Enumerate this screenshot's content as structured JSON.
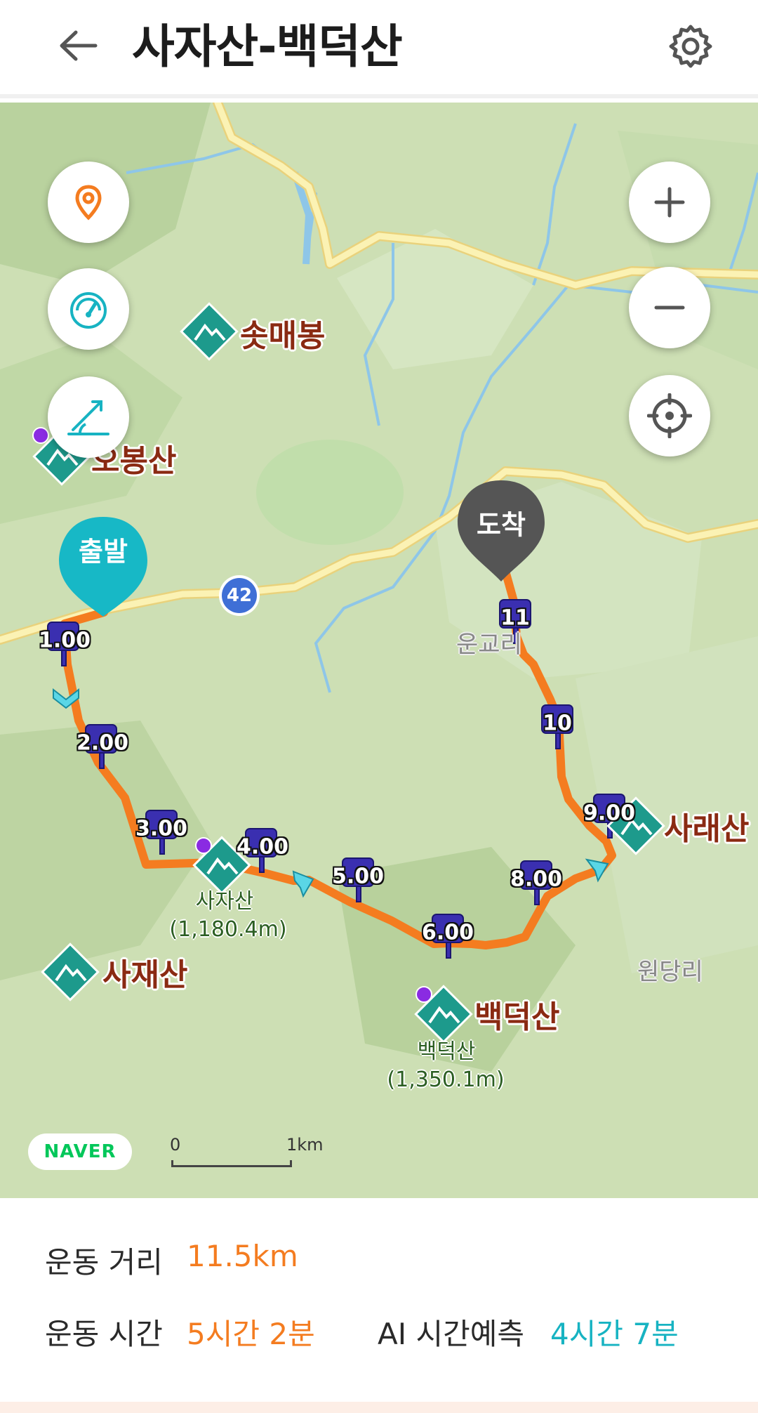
{
  "header": {
    "title": "사자산-백덕산",
    "back_icon": "arrow-left-icon",
    "settings_icon": "gear-icon"
  },
  "map": {
    "labels": {
      "sotmaebong": "솟매봉",
      "obongsan": "오봉산",
      "sajasan": "사자산",
      "sajasan_sub": "사자산",
      "sajasan_height": "(1,180.4m)",
      "sajaesan": "사재산",
      "baekdeoksan": "백덕산",
      "baekdeoksan_sub": "백덕산",
      "baekdeoksan_height": "(1,350.1m)",
      "saraesan": "사래산",
      "ungyori": "운교리",
      "wondangri": "원당리"
    },
    "start_pin": "출발",
    "end_pin": "도착",
    "route_number": "42",
    "km_markers": [
      "1.00",
      "2.00",
      "3.00",
      "4.00",
      "5.00",
      "6.00",
      "8.00",
      "9.00",
      "10",
      "11"
    ],
    "naver_logo": "NAVER",
    "scale": {
      "start": "0",
      "end": "1km"
    },
    "controls": {
      "location": "location-pin-icon",
      "speed": "speedometer-icon",
      "elevation": "elevation-chart-icon",
      "zoom_in": "plus-icon",
      "zoom_out": "minus-icon",
      "my_location": "crosshair-icon"
    },
    "colors": {
      "route": "#f47c20",
      "start_pin": "#17b8c6",
      "end_pin": "#555555",
      "marker": "#3a2fb0"
    }
  },
  "stats": {
    "distance_label": "운동 거리",
    "distance_value": "11.5km",
    "time_label": "운동 시간",
    "time_value": "5시간 2분",
    "ai_label": "AI 시간예측",
    "ai_value": "4시간 7분"
  }
}
